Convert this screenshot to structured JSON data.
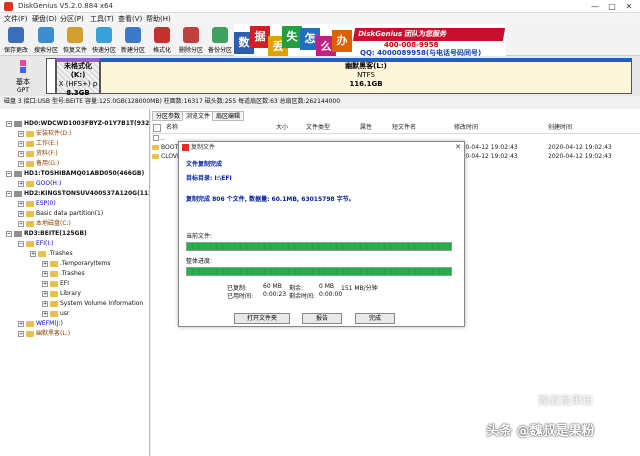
{
  "app": {
    "title": "DiskGenius V5.2.0.884 x64",
    "win_min": "—",
    "win_max": "□",
    "win_close": "✕"
  },
  "menu": [
    "文件(F)",
    "硬盘(D)",
    "分区(P)",
    "工具(T)",
    "查看(V)",
    "帮助(H)"
  ],
  "toolbar": [
    {
      "label": "保存更改",
      "color": "#3a6fb8"
    },
    {
      "label": "搜索分区",
      "color": "#3a8fd0"
    },
    {
      "label": "恢复文件",
      "color": "#d0a030"
    },
    {
      "label": "快速分区",
      "color": "#3aa0d8"
    },
    {
      "label": "新建分区",
      "color": "#3a7ac8"
    },
    {
      "label": "格式化",
      "color": "#c83030"
    },
    {
      "label": "删除分区",
      "color": "#c04040"
    },
    {
      "label": "备份分区",
      "color": "#40a060"
    }
  ],
  "banner": {
    "tiles": [
      {
        "char": "数",
        "color": "#2a5fb0"
      },
      {
        "char": "据",
        "color": "#d02020"
      },
      {
        "char": "丢",
        "color": "#e0a000"
      },
      {
        "char": "失",
        "color": "#20a040"
      },
      {
        "char": "怎",
        "color": "#2070c0"
      },
      {
        "char": "么",
        "color": "#c02080"
      },
      {
        "char": "办",
        "color": "#e06000"
      }
    ],
    "tagline": "DiskGenius 团队为您服务",
    "phone": "400-008-9958",
    "qq": "QQ: 4000089958(与电话号码同号)"
  },
  "diskmap": {
    "disk_label": "基本",
    "disk_type": "GPT",
    "partitions": [
      {
        "name": "未格式化(K:)",
        "fs": "X (HFS+) p",
        "size": "8.3GB"
      },
      {
        "name": "幽默黑客(L:)",
        "fs": "NTFS",
        "size": "116.1GB"
      }
    ]
  },
  "diskinfo": "磁盘 3 接口:USB  型号:BEITE  容量:125.0GB(128000MB)  柱面数:16317  磁头数:255  每道扇区数:63  总扇区数:262144000",
  "tree": [
    {
      "text": "HD0:WDCWD1003FBYZ-01Y7B1T(932GB)",
      "indent": 0,
      "style": "t-black t-bold",
      "kind": "hd",
      "exp": "−"
    },
    {
      "text": "安装软件(D:)",
      "indent": 1,
      "style": "t-brown",
      "kind": "fold",
      "exp": "+"
    },
    {
      "text": "工作(E:)",
      "indent": 1,
      "style": "t-brown",
      "kind": "fold",
      "exp": "+"
    },
    {
      "text": "资料(F:)",
      "indent": 1,
      "style": "t-brown",
      "kind": "fold",
      "exp": "+"
    },
    {
      "text": "备用(G:)",
      "indent": 1,
      "style": "t-brown",
      "kind": "fold",
      "exp": "+"
    },
    {
      "text": "HD1:TOSHIBAMQ01ABD050(466GB)",
      "indent": 0,
      "style": "t-black t-bold",
      "kind": "hd",
      "exp": "−"
    },
    {
      "text": "GOO(H:)",
      "indent": 1,
      "style": "t-blue",
      "kind": "fold",
      "exp": "+"
    },
    {
      "text": "HD2:KINGSTONSUV400S37A120G(112GB)",
      "indent": 0,
      "style": "t-black t-bold",
      "kind": "hd",
      "exp": "−"
    },
    {
      "text": "ESP(0)",
      "indent": 1,
      "style": "t-blue",
      "kind": "fold",
      "exp": "+"
    },
    {
      "text": "Basic data partition(1)",
      "indent": 1,
      "style": "t-black",
      "kind": "fold",
      "exp": "+"
    },
    {
      "text": "本地磁盘(C:)",
      "indent": 1,
      "style": "t-brown",
      "kind": "fold",
      "exp": "+"
    },
    {
      "text": "RD3:BEITE(125GB)",
      "indent": 0,
      "style": "t-black t-bold",
      "kind": "hd",
      "exp": "−"
    },
    {
      "text": "EFI(I:)",
      "indent": 1,
      "style": "t-blue",
      "kind": "fold",
      "exp": "−"
    },
    {
      "text": ".Trashes",
      "indent": 2,
      "style": "t-black",
      "kind": "fold",
      "exp": "+"
    },
    {
      "text": ".TemporaryItems",
      "indent": 3,
      "style": "t-black",
      "kind": "fold",
      "exp": "+"
    },
    {
      "text": ".Trashes",
      "indent": 3,
      "style": "t-black",
      "kind": "fold",
      "exp": "+"
    },
    {
      "text": "EFI",
      "indent": 3,
      "style": "t-black",
      "kind": "fold",
      "exp": "+"
    },
    {
      "text": "Library",
      "indent": 3,
      "style": "t-black",
      "kind": "fold",
      "exp": "+"
    },
    {
      "text": "System Volume Information",
      "indent": 3,
      "style": "t-black",
      "kind": "fold",
      "exp": "+"
    },
    {
      "text": "usr",
      "indent": 3,
      "style": "t-black",
      "kind": "fold",
      "exp": "+"
    },
    {
      "text": "WEFM(J:)",
      "indent": 1,
      "style": "t-blue",
      "kind": "fold",
      "exp": "+"
    },
    {
      "text": "幽默黑客(L:)",
      "indent": 1,
      "style": "t-brown",
      "kind": "fold",
      "exp": "+"
    }
  ],
  "tabs": [
    "分区参数",
    "浏览文件",
    "扇区编辑"
  ],
  "columns": [
    "名称",
    "大小",
    "文件类型",
    "属性",
    "短文件名",
    "修改时间",
    "创建时间"
  ],
  "files": [
    {
      "name": "..",
      "modified": "",
      "created": ""
    },
    {
      "name": "BOOT",
      "modified": "2020-04-12 19:02:43",
      "created": "2020-04-12 19:02:43"
    },
    {
      "name": "CLOVER",
      "modified": "2020-04-12 19:02:43",
      "created": "2020-04-12 19:02:43"
    }
  ],
  "dialog": {
    "title": "复制文件",
    "heading": "文件复制完成",
    "target": "目标目录: I:\\EFI",
    "done": "复制完成 806 个文件, 数据量: 60.1MB, 63015798 字节。",
    "current_label": "当前文件:",
    "overall_label": "整体进度:",
    "current_progress": 1.0,
    "overall_progress": 1.0,
    "copied_label": "已复制:",
    "copied_value": "60 MB",
    "remain_label": "剩余:",
    "remain_value": "0 MB",
    "speed": "151 MB/分钟",
    "elapsed_label": "已用时间:",
    "elapsed_value": "0:00:23",
    "remain_time_label": "剩余时间:",
    "remain_time_value": "0:00:00",
    "btn_open": "打开文件夹",
    "btn_report": "报告",
    "btn_done": "完成"
  },
  "watermark": {
    "line1": "头条 @魏叔是果粉",
    "line2": "魏叔是果粉"
  }
}
